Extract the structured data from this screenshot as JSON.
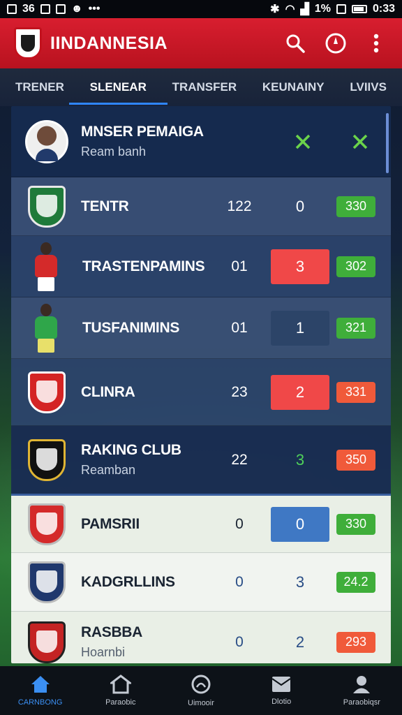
{
  "status_bar": {
    "left_text": "36",
    "battery_text": "1%",
    "time": "0:33"
  },
  "app_bar": {
    "title": "IINDANNESIA",
    "icons": [
      "search-icon",
      "compass-icon",
      "more-vert-icon"
    ]
  },
  "tabs": [
    {
      "label": "TRENER"
    },
    {
      "label": "SLENEAR"
    },
    {
      "label": "TRANSFER"
    },
    {
      "label": "KEUNAINY"
    },
    {
      "label": "LVIIVS"
    }
  ],
  "header_row": {
    "name": "MNSER PEMAIGA",
    "sub": "Ream banh"
  },
  "rows": [
    {
      "name": "TENTR",
      "a": "122",
      "b": "0",
      "badge": "330",
      "badge_color": "#3fae3a"
    },
    {
      "name": "TRASTENPAMINS",
      "a": "01",
      "b": "3",
      "badge": "302",
      "badge_color": "#3fae3a"
    },
    {
      "name": "TUSFANIMINS",
      "a": "01",
      "b": "1",
      "badge": "321",
      "badge_color": "#3fae3a"
    },
    {
      "name": "CLINRA",
      "a": "23",
      "b": "2",
      "badge": "331",
      "badge_color": "#f05a3a"
    },
    {
      "name": "RAKING CLUB",
      "sub": "Reamban",
      "a": "22",
      "b": "3",
      "badge": "350",
      "badge_color": "#f05a3a"
    },
    {
      "name": "PAMSRII",
      "a": "0",
      "b": "0",
      "badge": "330",
      "badge_color": "#3fae3a"
    },
    {
      "name": "KADGRLLINS",
      "a": "0",
      "b": "3",
      "badge": "24.2",
      "badge_color": "#3fae3a"
    },
    {
      "name": "RASBBA",
      "sub": "Hoarnbi",
      "a": "0",
      "b": "2",
      "badge": "293",
      "badge_color": "#f05a3a"
    }
  ],
  "bottom_nav": [
    {
      "label": "CARNBONG",
      "icon": "home-icon"
    },
    {
      "label": "Paraobic",
      "icon": "house-icon"
    },
    {
      "label": "Uimooir",
      "icon": "search-circle-icon"
    },
    {
      "label": "Dlotio",
      "icon": "inbox-icon"
    },
    {
      "label": "Paraobiqsr",
      "icon": "person-icon"
    }
  ]
}
